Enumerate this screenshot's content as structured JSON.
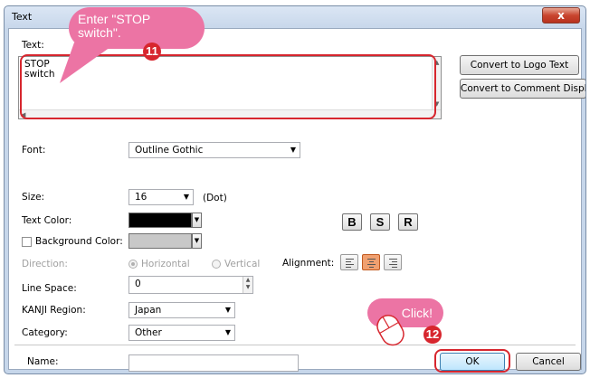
{
  "window": {
    "title": "Text",
    "close_glyph": "x"
  },
  "text_section": {
    "label": "Text:",
    "value": "STOP\nswitch"
  },
  "buttons": {
    "convert_logo": "Convert to Logo Text",
    "convert_comment": "Convert to Comment Display",
    "ok": "OK",
    "cancel": "Cancel"
  },
  "font": {
    "label": "Font:",
    "value": "Outline Gothic"
  },
  "size": {
    "label": "Size:",
    "value": "16",
    "unit": "(Dot)"
  },
  "text_color": {
    "label": "Text Color:",
    "color": "#000000"
  },
  "background_color": {
    "label": "Background Color:",
    "color": "#c8c8c8",
    "checked": false
  },
  "style_buttons": {
    "bold": "B",
    "shadow": "S",
    "reverse": "R"
  },
  "direction": {
    "label": "Direction:",
    "options": [
      "Horizontal",
      "Vertical"
    ],
    "selected": "Horizontal",
    "enabled": false
  },
  "alignment": {
    "label": "Alignment:",
    "options": [
      "left",
      "center",
      "right"
    ],
    "selected": "center"
  },
  "line_space": {
    "label": "Line Space:",
    "value": "0"
  },
  "kanji_region": {
    "label": "KANJI Region:",
    "value": "Japan"
  },
  "category": {
    "label": "Category:",
    "value": "Other"
  },
  "name": {
    "label": "Name:",
    "value": ""
  },
  "callouts": {
    "enter": {
      "text": "Enter \"STOP switch\".",
      "step": "11"
    },
    "click": {
      "text": "Click!",
      "step": "12"
    }
  },
  "colors": {
    "highlight_red": "#d7262e",
    "callout_pink": "#ec74a4",
    "active_alignment": "#f0a070"
  }
}
